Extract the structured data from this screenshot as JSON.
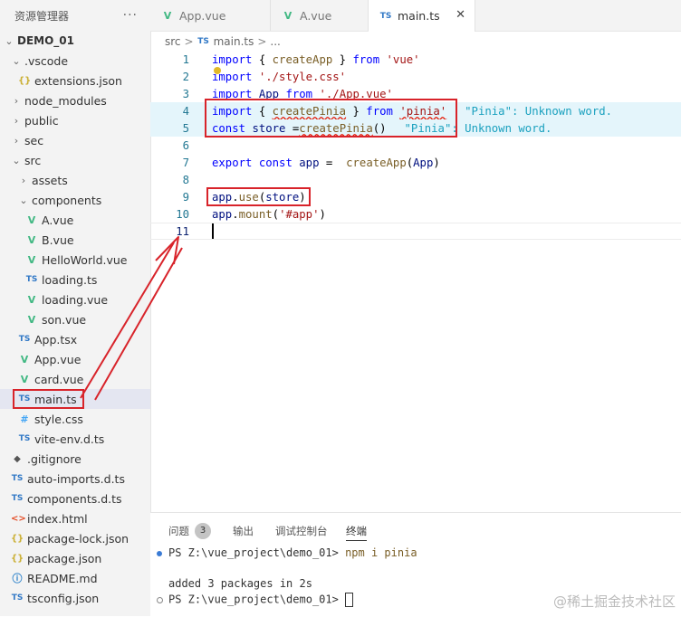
{
  "explorer": {
    "title": "资源管理器",
    "more": "···",
    "items": [
      {
        "label": "DEMO_01",
        "chevron": "⌄",
        "icon": ""
      },
      {
        "label": ".vscode",
        "chevron": "⌄",
        "icon": ""
      },
      {
        "label": "extensions.json",
        "chevron": "",
        "icon": "{}"
      },
      {
        "label": "node_modules",
        "chevron": "›",
        "icon": ""
      },
      {
        "label": "public",
        "chevron": "›",
        "icon": ""
      },
      {
        "label": "sec",
        "chevron": "›",
        "icon": ""
      },
      {
        "label": "src",
        "chevron": "⌄",
        "icon": ""
      },
      {
        "label": "assets",
        "chevron": "›",
        "icon": ""
      },
      {
        "label": "components",
        "chevron": "⌄",
        "icon": ""
      },
      {
        "label": "A.vue",
        "chevron": "",
        "icon": "V"
      },
      {
        "label": "B.vue",
        "chevron": "",
        "icon": "V"
      },
      {
        "label": "HelloWorld.vue",
        "chevron": "",
        "icon": "V"
      },
      {
        "label": "loading.ts",
        "chevron": "",
        "icon": "TS"
      },
      {
        "label": "loading.vue",
        "chevron": "",
        "icon": "V"
      },
      {
        "label": "son.vue",
        "chevron": "",
        "icon": "V"
      },
      {
        "label": "App.tsx",
        "chevron": "",
        "icon": "TS"
      },
      {
        "label": "App.vue",
        "chevron": "",
        "icon": "V"
      },
      {
        "label": "card.vue",
        "chevron": "",
        "icon": "V"
      },
      {
        "label": "main.ts",
        "chevron": "",
        "icon": "TS"
      },
      {
        "label": "style.css",
        "chevron": "",
        "icon": "#"
      },
      {
        "label": "vite-env.d.ts",
        "chevron": "",
        "icon": "TS"
      },
      {
        "label": ".gitignore",
        "chevron": "",
        "icon": "◆"
      },
      {
        "label": "auto-imports.d.ts",
        "chevron": "",
        "icon": "TS"
      },
      {
        "label": "components.d.ts",
        "chevron": "",
        "icon": "TS"
      },
      {
        "label": "index.html",
        "chevron": "",
        "icon": "<>"
      },
      {
        "label": "package-lock.json",
        "chevron": "",
        "icon": "{}"
      },
      {
        "label": "package.json",
        "chevron": "",
        "icon": "{}"
      },
      {
        "label": "README.md",
        "chevron": "",
        "icon": "ⓘ"
      },
      {
        "label": "tsconfig.json",
        "chevron": "",
        "icon": "TS"
      }
    ]
  },
  "tabs": [
    {
      "label": "App.vue",
      "icon": "V"
    },
    {
      "label": "A.vue",
      "icon": "V"
    },
    {
      "label": "main.ts",
      "icon": "TS",
      "close": "✕"
    }
  ],
  "breadcrumb": {
    "folder": "src",
    "sep": ">",
    "icon": "TS",
    "file": "main.ts",
    "more": "..."
  },
  "editor": {
    "line_numbers": [
      "1",
      "2",
      "3",
      "4",
      "5",
      "6",
      "7",
      "8",
      "9",
      "10",
      "11"
    ],
    "lines": [
      {
        "t": [
          "import",
          " { ",
          "createApp",
          " } ",
          "from",
          " ",
          "'vue'"
        ]
      },
      {
        "t": [
          "import",
          " ",
          "'./style.css'"
        ]
      },
      {
        "t": [
          "import",
          " ",
          "App",
          " ",
          "from",
          " ",
          "'./App.vue'"
        ]
      },
      {
        "t": [
          "import",
          " { ",
          "createPinia",
          " } ",
          "from",
          " ",
          "'pinia'"
        ],
        "hint": "\"Pinia\": Unknown word."
      },
      {
        "t": [
          "const",
          " ",
          "store",
          " =",
          "createPinia",
          "()"
        ],
        "hint": "\"Pinia\": Unknown word."
      },
      {
        "t": []
      },
      {
        "t": [
          "export",
          " ",
          "const",
          " ",
          "app",
          " =  ",
          "createApp",
          "(",
          "App",
          ")"
        ]
      },
      {
        "t": []
      },
      {
        "t": [
          "app",
          ".",
          "use",
          "(",
          "store",
          ")"
        ]
      },
      {
        "t": [
          "app",
          ".",
          "mount",
          "(",
          "'#app'",
          ")"
        ]
      },
      {
        "t": []
      }
    ]
  },
  "panel": {
    "tabs": [
      {
        "label": "问题",
        "badge": "3"
      },
      {
        "label": "输出"
      },
      {
        "label": "调试控制台"
      },
      {
        "label": "终端"
      }
    ],
    "terminal": [
      {
        "prompt": "PS Z:\\vue_project\\demo_01> ",
        "cmd": "npm i pinia"
      },
      {
        "text": "added 3 packages in 2s"
      },
      {
        "prompt": "PS Z:\\vue_project\\demo_01> ",
        "cmd": ""
      }
    ]
  },
  "watermark": "@稀土掘金技术社区",
  "colors": {
    "annotation": "#d8232a",
    "selection": "#e4e6f1",
    "highlight": "#e4f5fb"
  }
}
